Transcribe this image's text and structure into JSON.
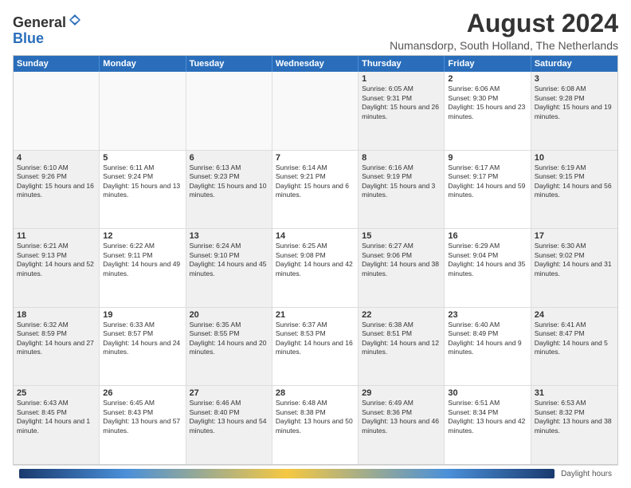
{
  "logo": {
    "general": "General",
    "blue": "Blue"
  },
  "title": {
    "month_year": "August 2024",
    "location": "Numansdorp, South Holland, The Netherlands"
  },
  "days_of_week": [
    "Sunday",
    "Monday",
    "Tuesday",
    "Wednesday",
    "Thursday",
    "Friday",
    "Saturday"
  ],
  "daylight_label": "Daylight hours",
  "weeks": [
    {
      "days": [
        {
          "num": "",
          "empty": true
        },
        {
          "num": "",
          "empty": true
        },
        {
          "num": "",
          "empty": true
        },
        {
          "num": "",
          "empty": true
        },
        {
          "num": "1",
          "sunrise": "Sunrise: 6:05 AM",
          "sunset": "Sunset: 9:31 PM",
          "daylight": "Daylight: 15 hours and 26 minutes."
        },
        {
          "num": "2",
          "sunrise": "Sunrise: 6:06 AM",
          "sunset": "Sunset: 9:30 PM",
          "daylight": "Daylight: 15 hours and 23 minutes."
        },
        {
          "num": "3",
          "sunrise": "Sunrise: 6:08 AM",
          "sunset": "Sunset: 9:28 PM",
          "daylight": "Daylight: 15 hours and 19 minutes."
        }
      ]
    },
    {
      "days": [
        {
          "num": "4",
          "sunrise": "Sunrise: 6:10 AM",
          "sunset": "Sunset: 9:26 PM",
          "daylight": "Daylight: 15 hours and 16 minutes."
        },
        {
          "num": "5",
          "sunrise": "Sunrise: 6:11 AM",
          "sunset": "Sunset: 9:24 PM",
          "daylight": "Daylight: 15 hours and 13 minutes."
        },
        {
          "num": "6",
          "sunrise": "Sunrise: 6:13 AM",
          "sunset": "Sunset: 9:23 PM",
          "daylight": "Daylight: 15 hours and 10 minutes."
        },
        {
          "num": "7",
          "sunrise": "Sunrise: 6:14 AM",
          "sunset": "Sunset: 9:21 PM",
          "daylight": "Daylight: 15 hours and 6 minutes."
        },
        {
          "num": "8",
          "sunrise": "Sunrise: 6:16 AM",
          "sunset": "Sunset: 9:19 PM",
          "daylight": "Daylight: 15 hours and 3 minutes."
        },
        {
          "num": "9",
          "sunrise": "Sunrise: 6:17 AM",
          "sunset": "Sunset: 9:17 PM",
          "daylight": "Daylight: 14 hours and 59 minutes."
        },
        {
          "num": "10",
          "sunrise": "Sunrise: 6:19 AM",
          "sunset": "Sunset: 9:15 PM",
          "daylight": "Daylight: 14 hours and 56 minutes."
        }
      ]
    },
    {
      "days": [
        {
          "num": "11",
          "sunrise": "Sunrise: 6:21 AM",
          "sunset": "Sunset: 9:13 PM",
          "daylight": "Daylight: 14 hours and 52 minutes."
        },
        {
          "num": "12",
          "sunrise": "Sunrise: 6:22 AM",
          "sunset": "Sunset: 9:11 PM",
          "daylight": "Daylight: 14 hours and 49 minutes."
        },
        {
          "num": "13",
          "sunrise": "Sunrise: 6:24 AM",
          "sunset": "Sunset: 9:10 PM",
          "daylight": "Daylight: 14 hours and 45 minutes."
        },
        {
          "num": "14",
          "sunrise": "Sunrise: 6:25 AM",
          "sunset": "Sunset: 9:08 PM",
          "daylight": "Daylight: 14 hours and 42 minutes."
        },
        {
          "num": "15",
          "sunrise": "Sunrise: 6:27 AM",
          "sunset": "Sunset: 9:06 PM",
          "daylight": "Daylight: 14 hours and 38 minutes."
        },
        {
          "num": "16",
          "sunrise": "Sunrise: 6:29 AM",
          "sunset": "Sunset: 9:04 PM",
          "daylight": "Daylight: 14 hours and 35 minutes."
        },
        {
          "num": "17",
          "sunrise": "Sunrise: 6:30 AM",
          "sunset": "Sunset: 9:02 PM",
          "daylight": "Daylight: 14 hours and 31 minutes."
        }
      ]
    },
    {
      "days": [
        {
          "num": "18",
          "sunrise": "Sunrise: 6:32 AM",
          "sunset": "Sunset: 8:59 PM",
          "daylight": "Daylight: 14 hours and 27 minutes."
        },
        {
          "num": "19",
          "sunrise": "Sunrise: 6:33 AM",
          "sunset": "Sunset: 8:57 PM",
          "daylight": "Daylight: 14 hours and 24 minutes."
        },
        {
          "num": "20",
          "sunrise": "Sunrise: 6:35 AM",
          "sunset": "Sunset: 8:55 PM",
          "daylight": "Daylight: 14 hours and 20 minutes."
        },
        {
          "num": "21",
          "sunrise": "Sunrise: 6:37 AM",
          "sunset": "Sunset: 8:53 PM",
          "daylight": "Daylight: 14 hours and 16 minutes."
        },
        {
          "num": "22",
          "sunrise": "Sunrise: 6:38 AM",
          "sunset": "Sunset: 8:51 PM",
          "daylight": "Daylight: 14 hours and 12 minutes."
        },
        {
          "num": "23",
          "sunrise": "Sunrise: 6:40 AM",
          "sunset": "Sunset: 8:49 PM",
          "daylight": "Daylight: 14 hours and 9 minutes."
        },
        {
          "num": "24",
          "sunrise": "Sunrise: 6:41 AM",
          "sunset": "Sunset: 8:47 PM",
          "daylight": "Daylight: 14 hours and 5 minutes."
        }
      ]
    },
    {
      "days": [
        {
          "num": "25",
          "sunrise": "Sunrise: 6:43 AM",
          "sunset": "Sunset: 8:45 PM",
          "daylight": "Daylight: 14 hours and 1 minute."
        },
        {
          "num": "26",
          "sunrise": "Sunrise: 6:45 AM",
          "sunset": "Sunset: 8:43 PM",
          "daylight": "Daylight: 13 hours and 57 minutes."
        },
        {
          "num": "27",
          "sunrise": "Sunrise: 6:46 AM",
          "sunset": "Sunset: 8:40 PM",
          "daylight": "Daylight: 13 hours and 54 minutes."
        },
        {
          "num": "28",
          "sunrise": "Sunrise: 6:48 AM",
          "sunset": "Sunset: 8:38 PM",
          "daylight": "Daylight: 13 hours and 50 minutes."
        },
        {
          "num": "29",
          "sunrise": "Sunrise: 6:49 AM",
          "sunset": "Sunset: 8:36 PM",
          "daylight": "Daylight: 13 hours and 46 minutes."
        },
        {
          "num": "30",
          "sunrise": "Sunrise: 6:51 AM",
          "sunset": "Sunset: 8:34 PM",
          "daylight": "Daylight: 13 hours and 42 minutes."
        },
        {
          "num": "31",
          "sunrise": "Sunrise: 6:53 AM",
          "sunset": "Sunset: 8:32 PM",
          "daylight": "Daylight: 13 hours and 38 minutes."
        }
      ]
    }
  ]
}
